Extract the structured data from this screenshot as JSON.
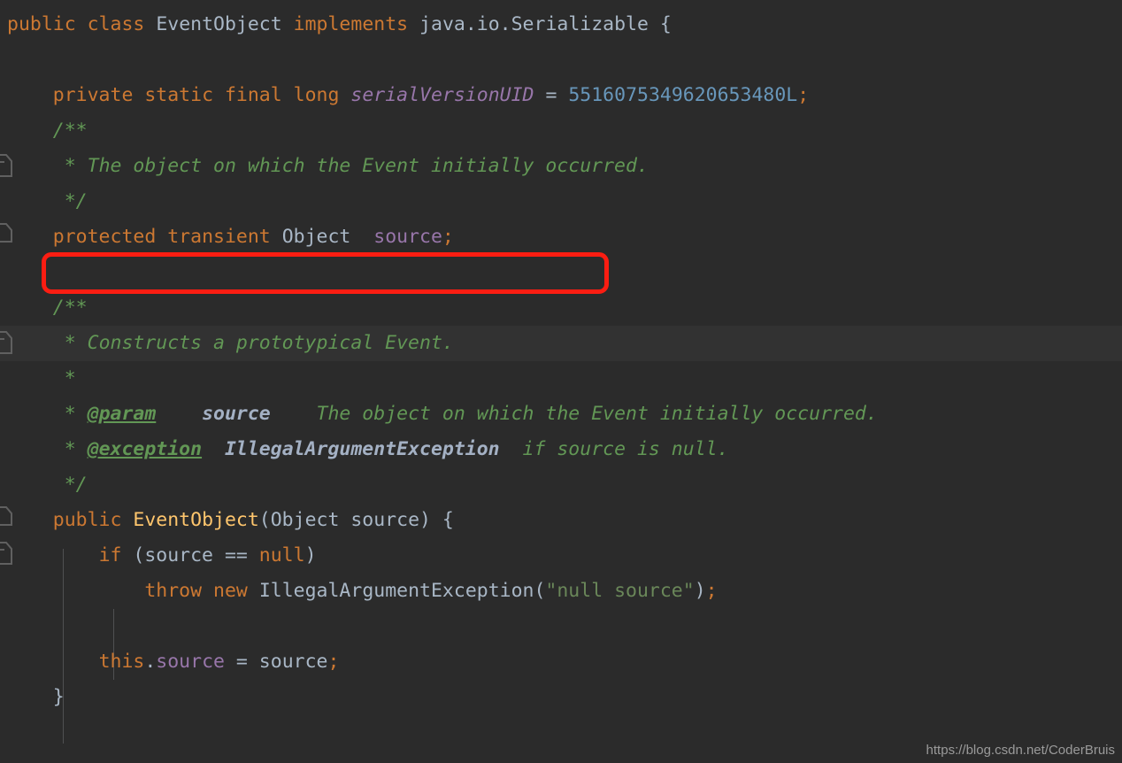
{
  "editor": {
    "theme_name": "darcula",
    "background_color": "#2b2b2b",
    "highlight_band_color": "#323232",
    "indent_guide_color": "#4f5052",
    "language": "java",
    "annotation": {
      "shape": "rounded-rectangle",
      "color": "#fb1d12",
      "target_text": "protected transient Object  source;"
    },
    "watermark": "https://blog.csdn.net/CoderBruis",
    "gutter_icons": [
      {
        "name": "javadoc-fold-start-icon",
        "row": 3
      },
      {
        "name": "javadoc-fold-end-icon",
        "row": 5
      },
      {
        "name": "javadoc-fold-start-icon",
        "row": 8
      },
      {
        "name": "javadoc-fold-end-icon",
        "row": 13
      },
      {
        "name": "method-fold-start-icon",
        "row": 14
      }
    ],
    "lines": [
      {
        "row": 0,
        "tokens": [
          {
            "t": "public",
            "c": "kw"
          },
          {
            "t": " ",
            "c": "plain"
          },
          {
            "t": "class",
            "c": "kw"
          },
          {
            "t": " ",
            "c": "plain"
          },
          {
            "t": "EventObject",
            "c": "plain"
          },
          {
            "t": " ",
            "c": "plain"
          },
          {
            "t": "implements",
            "c": "kw"
          },
          {
            "t": " java.io.Serializable {",
            "c": "plain"
          }
        ]
      },
      {
        "row": 1,
        "tokens": []
      },
      {
        "row": 2,
        "tokens": [
          {
            "t": "    ",
            "c": "plain"
          },
          {
            "t": "private",
            "c": "kw"
          },
          {
            "t": " ",
            "c": "plain"
          },
          {
            "t": "static",
            "c": "kw"
          },
          {
            "t": " ",
            "c": "plain"
          },
          {
            "t": "final",
            "c": "kw"
          },
          {
            "t": " ",
            "c": "plain"
          },
          {
            "t": "long",
            "c": "kw"
          },
          {
            "t": " ",
            "c": "plain"
          },
          {
            "t": "serialVersionUID",
            "c": "field italic"
          },
          {
            "t": " = ",
            "c": "plain"
          },
          {
            "t": "5516075349620653480L",
            "c": "num"
          },
          {
            "t": ";",
            "c": "kw"
          }
        ]
      },
      {
        "row": 3,
        "tokens": [
          {
            "t": "    ",
            "c": "plain"
          },
          {
            "t": "/**",
            "c": "cmt"
          }
        ]
      },
      {
        "row": 4,
        "tokens": [
          {
            "t": "     ",
            "c": "plain"
          },
          {
            "t": "* The object on which the Event initially occurred.",
            "c": "cmt"
          }
        ]
      },
      {
        "row": 5,
        "tokens": [
          {
            "t": "     ",
            "c": "plain"
          },
          {
            "t": "*/",
            "c": "cmt"
          }
        ]
      },
      {
        "row": 6,
        "tokens": [
          {
            "t": "    ",
            "c": "plain"
          },
          {
            "t": "protected",
            "c": "kw"
          },
          {
            "t": " ",
            "c": "plain"
          },
          {
            "t": "transient",
            "c": "kw"
          },
          {
            "t": " ",
            "c": "plain"
          },
          {
            "t": "Object",
            "c": "plain"
          },
          {
            "t": "  ",
            "c": "plain"
          },
          {
            "t": "source",
            "c": "field"
          },
          {
            "t": ";",
            "c": "kw"
          }
        ]
      },
      {
        "row": 7,
        "tokens": []
      },
      {
        "row": 8,
        "tokens": [
          {
            "t": "    ",
            "c": "plain"
          },
          {
            "t": "/**",
            "c": "cmt"
          }
        ]
      },
      {
        "row": 9,
        "tokens": [
          {
            "t": "     ",
            "c": "plain"
          },
          {
            "t": "* Constructs a prototypical Event.",
            "c": "cmt"
          }
        ]
      },
      {
        "row": 10,
        "tokens": [
          {
            "t": "     ",
            "c": "plain"
          },
          {
            "t": "*",
            "c": "cmt"
          }
        ]
      },
      {
        "row": 11,
        "tokens": [
          {
            "t": "     ",
            "c": "plain"
          },
          {
            "t": "* ",
            "c": "cmt"
          },
          {
            "t": "@param",
            "c": "cmt-tag"
          },
          {
            "t": "    ",
            "c": "cmt"
          },
          {
            "t": "source",
            "c": "cmt-ref"
          },
          {
            "t": "    ",
            "c": "cmt"
          },
          {
            "t": "The object on which the Event initially occurred.",
            "c": "cmt"
          }
        ]
      },
      {
        "row": 12,
        "tokens": [
          {
            "t": "     ",
            "c": "plain"
          },
          {
            "t": "* ",
            "c": "cmt"
          },
          {
            "t": "@exception",
            "c": "cmt-tag"
          },
          {
            "t": "  ",
            "c": "cmt"
          },
          {
            "t": "IllegalArgumentException",
            "c": "cmt-ref"
          },
          {
            "t": "  ",
            "c": "cmt"
          },
          {
            "t": "if source is null.",
            "c": "cmt"
          }
        ]
      },
      {
        "row": 13,
        "tokens": [
          {
            "t": "     ",
            "c": "plain"
          },
          {
            "t": "*/",
            "c": "cmt"
          }
        ]
      },
      {
        "row": 14,
        "tokens": [
          {
            "t": "    ",
            "c": "plain"
          },
          {
            "t": "public",
            "c": "kw"
          },
          {
            "t": " ",
            "c": "plain"
          },
          {
            "t": "EventObject",
            "c": "clsname"
          },
          {
            "t": "(Object source) {",
            "c": "plain"
          }
        ]
      },
      {
        "row": 15,
        "tokens": [
          {
            "t": "        ",
            "c": "plain"
          },
          {
            "t": "if",
            "c": "kw"
          },
          {
            "t": " (source == ",
            "c": "plain"
          },
          {
            "t": "null",
            "c": "kw"
          },
          {
            "t": ")",
            "c": "plain"
          }
        ]
      },
      {
        "row": 16,
        "tokens": [
          {
            "t": "            ",
            "c": "plain"
          },
          {
            "t": "throw",
            "c": "kw"
          },
          {
            "t": " ",
            "c": "plain"
          },
          {
            "t": "new",
            "c": "kw"
          },
          {
            "t": " IllegalArgumentException(",
            "c": "plain"
          },
          {
            "t": "\"null source\"",
            "c": "str"
          },
          {
            "t": ")",
            "c": "plain"
          },
          {
            "t": ";",
            "c": "kw"
          }
        ]
      },
      {
        "row": 17,
        "tokens": []
      },
      {
        "row": 18,
        "tokens": [
          {
            "t": "        ",
            "c": "plain"
          },
          {
            "t": "this",
            "c": "kw"
          },
          {
            "t": ".",
            "c": "plain"
          },
          {
            "t": "source",
            "c": "field"
          },
          {
            "t": " = source",
            "c": "plain"
          },
          {
            "t": ";",
            "c": "kw"
          }
        ]
      },
      {
        "row": 19,
        "tokens": [
          {
            "t": "    ",
            "c": "plain"
          },
          {
            "t": "}",
            "c": "plain"
          }
        ]
      }
    ]
  }
}
